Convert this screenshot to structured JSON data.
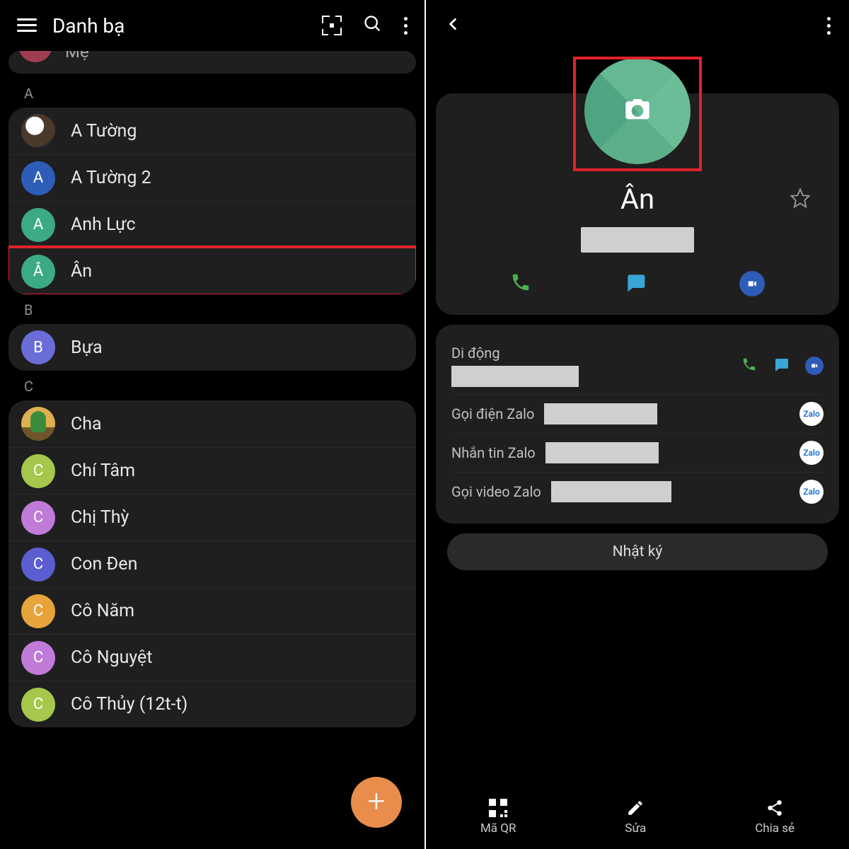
{
  "left": {
    "title": "Danh bạ",
    "peek_name": "Mẹ",
    "sections": [
      {
        "letter": "A",
        "items": [
          {
            "initial": "",
            "avatar": "img-coffee",
            "color": "",
            "name": "A Tường"
          },
          {
            "initial": "A",
            "avatar": "",
            "color": "#2d5db8",
            "name": "A Tường 2"
          },
          {
            "initial": "A",
            "avatar": "",
            "color": "#3caa83",
            "name": "Anh Lực"
          },
          {
            "initial": "Â",
            "avatar": "",
            "color": "#3caa83",
            "name": "Ân"
          }
        ]
      },
      {
        "letter": "B",
        "items": [
          {
            "initial": "B",
            "avatar": "",
            "color": "#6a6dd8",
            "name": "Bựa"
          }
        ]
      },
      {
        "letter": "C",
        "items": [
          {
            "initial": "",
            "avatar": "img-cactus",
            "color": "",
            "name": "Cha"
          },
          {
            "initial": "C",
            "avatar": "",
            "color": "#a5c74c",
            "name": "Chí Tâm"
          },
          {
            "initial": "C",
            "avatar": "",
            "color": "#c07ad8",
            "name": "Chị Thỳ"
          },
          {
            "initial": "C",
            "avatar": "",
            "color": "#5a5ed0",
            "name": "Con Đen"
          },
          {
            "initial": "C",
            "avatar": "",
            "color": "#e7a43b",
            "name": "Cô Năm"
          },
          {
            "initial": "C",
            "avatar": "",
            "color": "#c07ad8",
            "name": "Cô Nguyệt"
          },
          {
            "initial": "C",
            "avatar": "",
            "color": "#a5c74c",
            "name": "Cô Thủy (12t-t)"
          }
        ]
      }
    ],
    "highlight_index": "Ân"
  },
  "right": {
    "name": "Ân",
    "mobile_label": "Di động",
    "zalo_call": "Gọi điện Zalo",
    "zalo_msg": "Nhắn tin Zalo",
    "zalo_video": "Gọi video Zalo",
    "zalo_badge": "Zalo",
    "journal": "Nhật ký",
    "bottom": {
      "qr": "Mã QR",
      "edit": "Sửa",
      "share": "Chia sẻ"
    }
  }
}
